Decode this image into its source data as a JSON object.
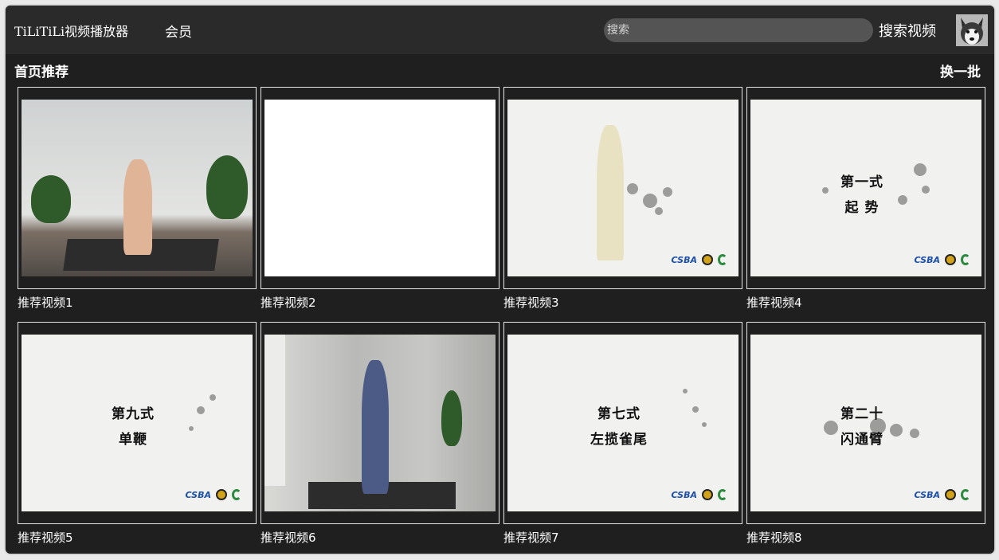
{
  "header": {
    "app_title": "TiLiTiLi视频播放器",
    "member_label": "会员",
    "search_placeholder": "搜索",
    "search_button_label": "搜索视频"
  },
  "section": {
    "title": "首页推荐",
    "refresh_label": "换一批"
  },
  "videos": [
    {
      "label": "推荐视频1",
      "caption": ""
    },
    {
      "label": "推荐视频2",
      "caption": ""
    },
    {
      "label": "推荐视频3",
      "caption": ""
    },
    {
      "label": "推荐视频4",
      "caption": "第一式\n起 势"
    },
    {
      "label": "推荐视频5",
      "caption": "第九式\n单鞭"
    },
    {
      "label": "推荐视频6",
      "caption": ""
    },
    {
      "label": "推荐视频7",
      "caption": "第七式\n左揽雀尾"
    },
    {
      "label": "推荐视频8",
      "caption": "第二十\n闪通臂"
    }
  ],
  "logos": {
    "csba": "CSBA"
  },
  "colors": {
    "window_bg": "#1f1f1f",
    "topbar_bg": "#2a2a2a",
    "search_bg": "#545454",
    "text": "#ffffff"
  }
}
